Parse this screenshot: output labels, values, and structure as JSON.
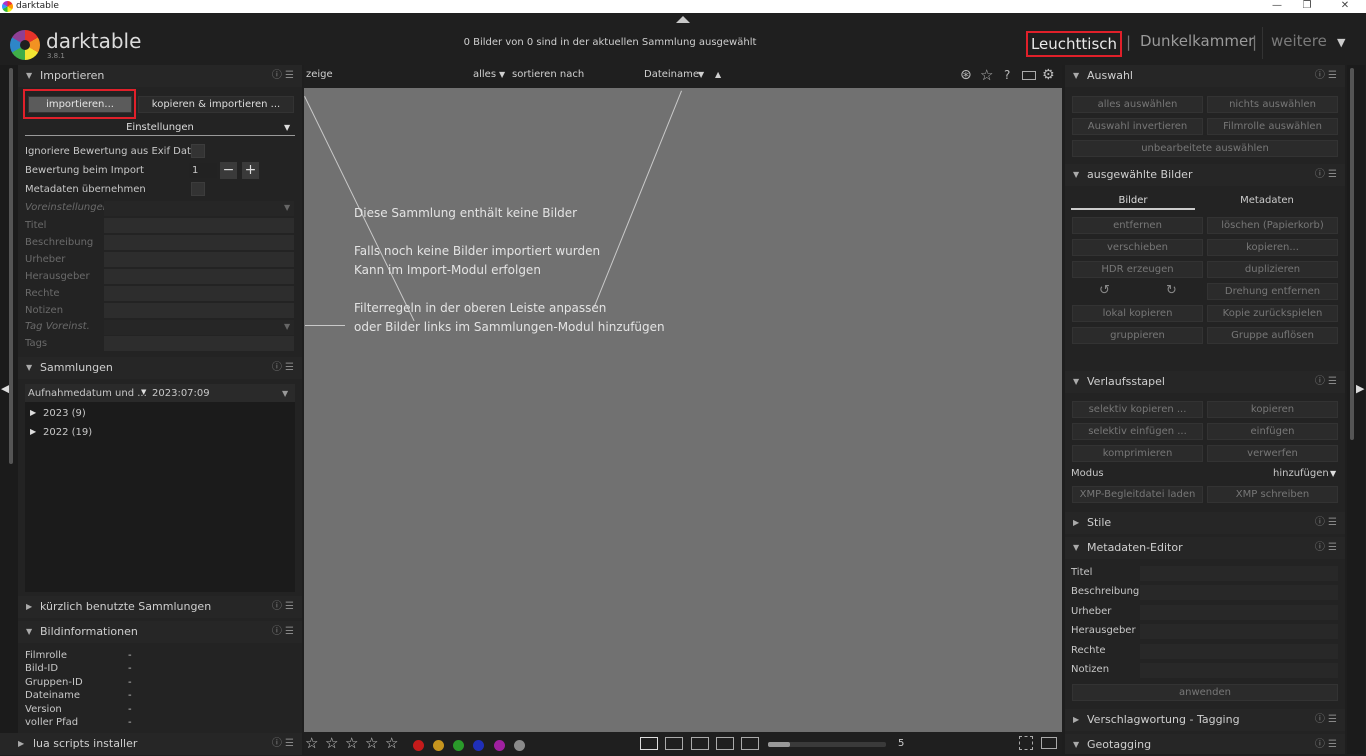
{
  "titlebar": {
    "title": "darktable",
    "min": "—",
    "max": "❐",
    "close": "✕"
  },
  "header": {
    "app_name": "darktable",
    "version": "3.8.1",
    "status": "0 Bilder von 0 sind in der aktuellen Sammlung ausgewählt",
    "views": {
      "lighttable": "Leuchttisch",
      "darkroom": "Dunkelkammer",
      "more": "weitere",
      "sep": "|",
      "more_arrow": "▼"
    }
  },
  "filterbar": {
    "show": "zeige",
    "all": "alles",
    "all_arrow": "▼",
    "sort_by": "sortieren nach",
    "sort_field": "Dateiname",
    "sort_arrow": "▼",
    "sort_dir": "▲",
    "icons": [
      "grouping-icon",
      "star-icon",
      "help-icon",
      "keyboard-icon",
      "gear-icon"
    ]
  },
  "left": {
    "import": {
      "title": "Importieren",
      "btn_import": "importieren...",
      "btn_copy_import": "kopieren & importieren ...",
      "settings": "Einstellungen",
      "settings_arrow": "▼",
      "ignore_exif": "Ignoriere Bewertung aus Exif Daten",
      "rating": "Bewertung beim Import",
      "rating_value": "1",
      "minus": "−",
      "plus": "+",
      "apply_meta": "Metadaten übernehmen",
      "presets": "Voreinstellungen",
      "fields": [
        "Titel",
        "Beschreibung",
        "Urheber",
        "Herausgeber",
        "Rechte",
        "Notizen"
      ],
      "tag_presets": "Tag Voreinst.",
      "tags": "Tags"
    },
    "collections": {
      "title": "Sammlungen",
      "filter_label": "Aufnahmedatum und ...",
      "filter_value": "2023:07:09",
      "items": [
        {
          "label": "2023 (9)"
        },
        {
          "label": "2022 (19)"
        }
      ]
    },
    "recent": {
      "title": "kürzlich benutzte Sammlungen"
    },
    "imageinfo": {
      "title": "Bildinformationen",
      "rows": [
        {
          "k": "Filmrolle",
          "v": "-"
        },
        {
          "k": "Bild-ID",
          "v": "-"
        },
        {
          "k": "Gruppen-ID",
          "v": "-"
        },
        {
          "k": "Dateiname",
          "v": "-"
        },
        {
          "k": "Version",
          "v": "-"
        },
        {
          "k": "voller Pfad",
          "v": "-"
        }
      ]
    },
    "lua": {
      "title": "lua scripts installer"
    }
  },
  "center": {
    "l1": "Diese Sammlung enthält keine Bilder",
    "l2": "Falls noch keine Bilder importiert wurden",
    "l3": "Kann im Import-Modul erfolgen",
    "l4": "Filterregeln in der oberen Leiste anpassen",
    "l5": "oder Bilder links im Sammlungen-Modul hinzufügen"
  },
  "right": {
    "select": {
      "title": "Auswahl",
      "all": "alles auswählen",
      "none": "nichts auswählen",
      "invert": "Auswahl invertieren",
      "film": "Filmrolle auswählen",
      "unedited": "unbearbeitete auswählen"
    },
    "selected": {
      "title": "ausgewählte Bilder",
      "tab_images": "Bilder",
      "tab_meta": "Metadaten",
      "remove": "entfernen",
      "trash": "löschen (Papierkorb)",
      "move": "verschieben",
      "copy": "kopieren...",
      "hdr": "HDR erzeugen",
      "duplicate": "duplizieren",
      "rot_left": "↺",
      "rot_right": "↻",
      "reset_rot": "Drehung entfernen",
      "local_copy": "lokal kopieren",
      "resync": "Kopie zurückspielen",
      "group": "gruppieren",
      "ungroup": "Gruppe auflösen"
    },
    "history": {
      "title": "Verlaufsstapel",
      "sel_copy": "selektiv kopieren ...",
      "copy": "kopieren",
      "sel_paste": "selektiv einfügen ...",
      "paste": "einfügen",
      "compress": "komprimieren",
      "discard": "verwerfen",
      "mode": "Modus",
      "mode_value": "hinzufügen",
      "mode_arrow": "▼",
      "load_xmp": "XMP-Begleitdatei laden",
      "write_xmp": "XMP schreiben"
    },
    "styles": {
      "title": "Stile"
    },
    "meta": {
      "title": "Metadaten-Editor",
      "fields": [
        "Titel",
        "Beschreibung",
        "Urheber",
        "Herausgeber",
        "Rechte",
        "Notizen"
      ],
      "apply": "anwenden"
    },
    "tagging": {
      "title": "Verschlagwortung - Tagging"
    },
    "geo": {
      "title": "Geotagging"
    }
  },
  "bottombar": {
    "stars": [
      "☆",
      "☆",
      "☆",
      "☆",
      "☆"
    ],
    "colors": [
      "#c41b1b",
      "#c7951e",
      "#2a9a2a",
      "#1f2fb8",
      "#a020a0",
      "#8a8a8a"
    ],
    "zoom": "5"
  },
  "icons": {
    "module_tri_open": "▼",
    "module_tri_closed": "▶",
    "module_icons": "ⓘ ☰"
  }
}
